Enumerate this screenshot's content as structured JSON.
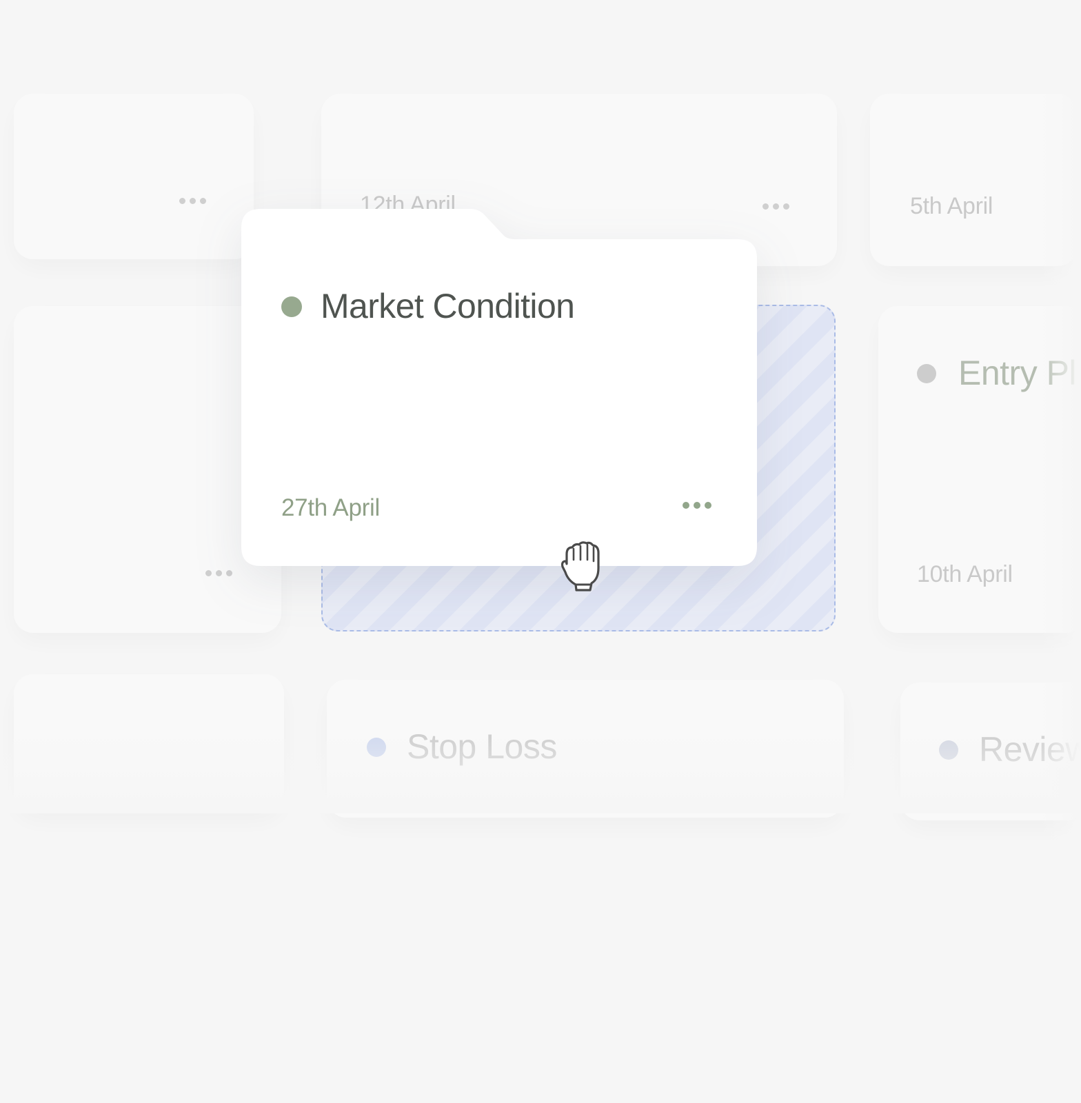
{
  "board": {
    "dragged_card": {
      "title": "Market Condition",
      "date": "27th April",
      "status_color": "#97a98f",
      "more_icon": "more-horizontal-icon"
    },
    "background_cards": [
      {
        "id": "top-left",
        "date": ""
      },
      {
        "id": "top-middle",
        "date": "12th April"
      },
      {
        "id": "top-right",
        "date": "5th April"
      },
      {
        "id": "middle-left",
        "date": ""
      },
      {
        "id": "middle-right",
        "title": "Entry Pl",
        "date": "10th April",
        "status_color": "#c7c7c7"
      },
      {
        "id": "bottom-left",
        "date": ""
      },
      {
        "id": "bottom-middle",
        "title": "Stop Loss",
        "status_color": "#c9d3ee"
      },
      {
        "id": "bottom-right",
        "title": "Review",
        "status_color": "#cfd3e0"
      }
    ],
    "drop_zone": {
      "accent_color": "#a9bbe6"
    },
    "cursor_icon": "grab-hand-icon"
  }
}
